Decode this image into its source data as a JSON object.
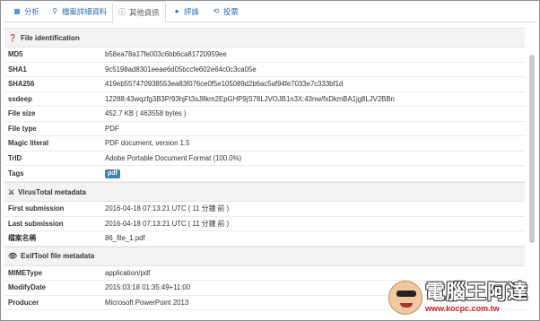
{
  "tabs": [
    {
      "icon": "bar-chart-icon",
      "glyph": "▦",
      "label": "分析"
    },
    {
      "icon": "search-icon",
      "glyph": "⚲",
      "label": "檔案詳細資料"
    },
    {
      "icon": "info-icon",
      "glyph": "ⓘ",
      "label": "其他資訊"
    },
    {
      "icon": "comment-icon",
      "glyph": "💬",
      "label": "評論"
    },
    {
      "icon": "vote-icon",
      "glyph": "⟲",
      "label": "投票"
    }
  ],
  "sections": {
    "file_identification": {
      "title": "File identification",
      "rows": [
        {
          "key": "MD5",
          "value": "b58ea78a17fe003c6bb6ca81720959ee"
        },
        {
          "key": "SHA1",
          "value": "9c5198ad8301eeae6d05bccfe602e64c0c3ca05e"
        },
        {
          "key": "SHA256",
          "value": "419eb557470938553ea83f076ce0f5e105089d2b6ac5af94fe7033e7c333bf1d"
        },
        {
          "key": "ssdeep",
          "value": "12288:43wqzfg3B3P/93hjFt3sJ8km2EpGHP9jS78LJVOJB1n3X:43nw/fxDkmBA1jg8LJV2BBn"
        },
        {
          "key": "File size",
          "value": "452.7 KB ( 463558 bytes )"
        },
        {
          "key": "File type",
          "value": "PDF"
        },
        {
          "key": "Magic literal",
          "value": "PDF document, version 1.5"
        },
        {
          "key": "TrID",
          "value": "Adobe Portable Document Format (100.0%)"
        }
      ],
      "tags_label": "Tags",
      "tag": "pdf"
    },
    "virustotal_metadata": {
      "title": "VirusTotal metadata",
      "rows": [
        {
          "key": "First submission",
          "value": "2016-04-18 07:13:21 UTC ( 11 分鐘 前 )"
        },
        {
          "key": "Last submission",
          "value": "2016-04-18 07:13:21 UTC ( 11 分鐘 前 )"
        },
        {
          "key": "檔案名稱",
          "value": "86_file_1.pdf"
        }
      ]
    },
    "exiftool_metadata": {
      "title": "ExifTool file metadata",
      "rows": [
        {
          "key": "MIMEType",
          "value": "application/pdf"
        },
        {
          "key": "ModifyDate",
          "value": "2015:03:18 01:35:49+11:00"
        },
        {
          "key": "Producer",
          "value": "Microsoft PowerPoint 2013"
        }
      ]
    }
  },
  "watermark": {
    "title": "電腦王阿達",
    "url": "www.kocpc.com.tw"
  }
}
